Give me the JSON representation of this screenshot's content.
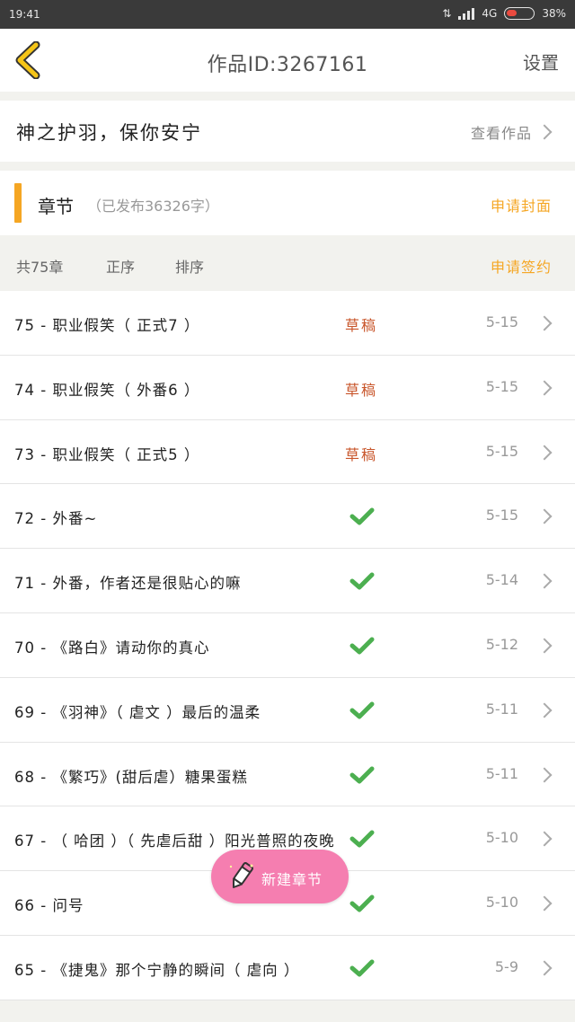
{
  "status_bar": {
    "time": "19:41",
    "network": "4G",
    "battery": "38%",
    "battery_level": 0.38
  },
  "header": {
    "title": "作品ID:3267161",
    "settings_label": "设置",
    "back_icon": "chevron-left-icon"
  },
  "work": {
    "name": "神之护羽，保你安宁",
    "view_label": "查看作品"
  },
  "chapters_section": {
    "title": "章节",
    "published": "（已发布36326字）",
    "apply_cover_label": "申请封面"
  },
  "toolbar": {
    "total": "共75章",
    "order_asc": "正序",
    "sort": "排序",
    "apply_sign_label": "申请签约"
  },
  "colors": {
    "accent": "#f5a623",
    "draft": "#c8552a",
    "check": "#4caf50",
    "fab": "#f57eb0"
  },
  "chapters": [
    {
      "title": "75 - 职业假笑（ 正式7 ）",
      "status": "草稿",
      "published": false,
      "date": "5-15"
    },
    {
      "title": "74 - 职业假笑（ 外番6 ）",
      "status": "草稿",
      "published": false,
      "date": "5-15"
    },
    {
      "title": "73 - 职业假笑（ 正式5 ）",
      "status": "草稿",
      "published": false,
      "date": "5-15"
    },
    {
      "title": "72 - 外番~",
      "status": "",
      "published": true,
      "date": "5-15"
    },
    {
      "title": "71 - 外番，作者还是很贴心的嘛",
      "status": "",
      "published": true,
      "date": "5-14"
    },
    {
      "title": "70 - 《路白》请动你的真心",
      "status": "",
      "published": true,
      "date": "5-12"
    },
    {
      "title": "69 - 《羽神》（ 虐文 ）最后的温柔",
      "status": "",
      "published": true,
      "date": "5-11"
    },
    {
      "title": "68 - 《繁巧》(甜后虐）糖果蛋糕",
      "status": "",
      "published": true,
      "date": "5-11"
    },
    {
      "title": "67 - （ 哈团 ）（ 先虐后甜 ）阳光普照的夜晚",
      "status": "",
      "published": true,
      "date": "5-10"
    },
    {
      "title": "66 - 问号",
      "status": "",
      "published": true,
      "date": "5-10"
    },
    {
      "title": "65 - 《捷鬼》那个宁静的瞬间（ 虐向 ）",
      "status": "",
      "published": true,
      "date": "5-9"
    }
  ],
  "fab": {
    "label": "新建章节",
    "icon": "pencil-icon"
  }
}
